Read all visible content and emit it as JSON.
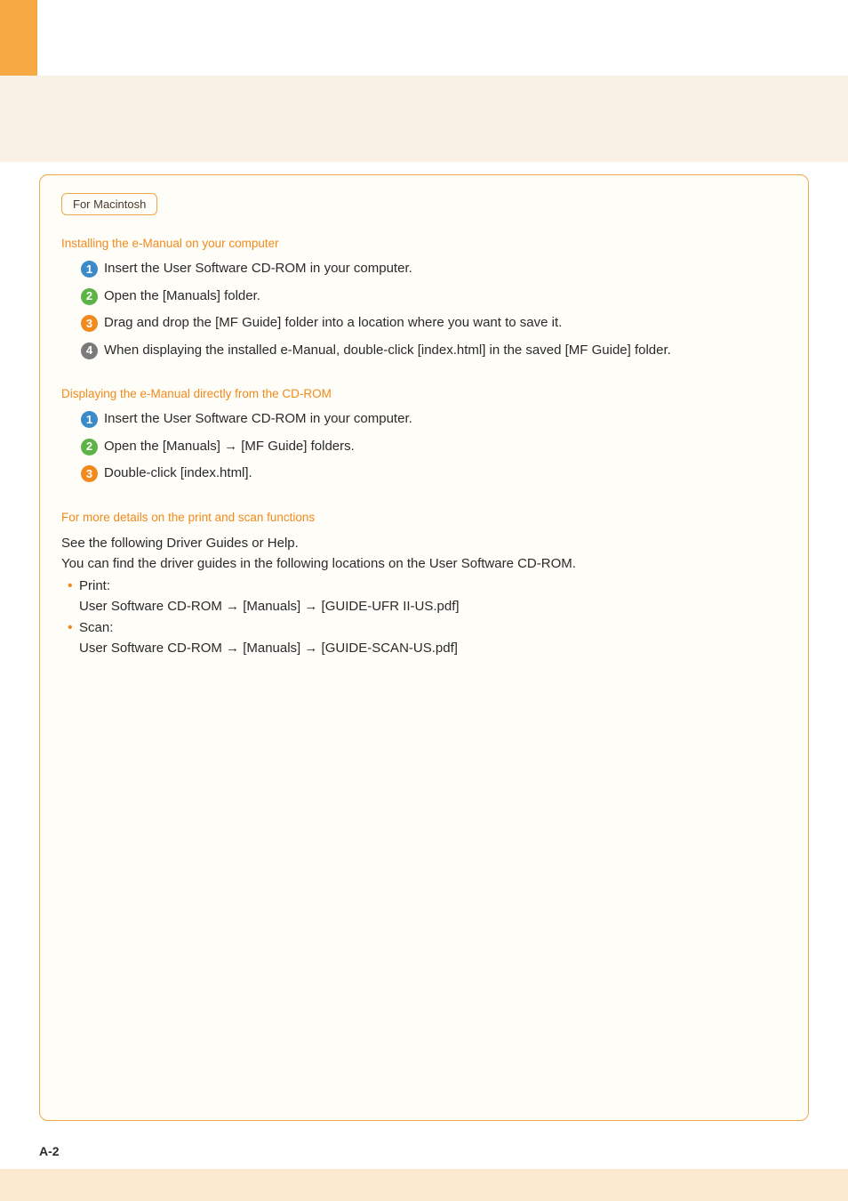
{
  "header": {
    "tab_label": "For Macintosh"
  },
  "section1": {
    "title": "Installing the e-Manual on your computer",
    "steps": [
      "Insert the User Software CD-ROM in your computer.",
      "Open the [Manuals] folder.",
      "Drag and drop the [MF Guide] folder into a location where you want to save it.",
      "When displaying the installed e-Manual, double-click [index.html] in the saved [MF Guide] folder."
    ]
  },
  "section2": {
    "title": "Displaying the e-Manual directly from the CD-ROM",
    "steps": [
      "Insert the User Software CD-ROM in your computer.",
      "Open the [Manuals] → [MF Guide] folders.",
      "Double-click [index.html]."
    ]
  },
  "section3": {
    "title": "For more details on the print and scan functions",
    "intro1": "See the following Driver Guides or Help.",
    "intro2": "You can find the driver guides in the following locations on the User Software CD-ROM.",
    "bullets": [
      {
        "label": "Print:",
        "path": "User Software CD-ROM → [Manuals] → [GUIDE-UFR II-US.pdf]"
      },
      {
        "label": "Scan:",
        "path": "User Software CD-ROM → [Manuals] → [GUIDE-SCAN-US.pdf]"
      }
    ]
  },
  "page_number": "A-2"
}
